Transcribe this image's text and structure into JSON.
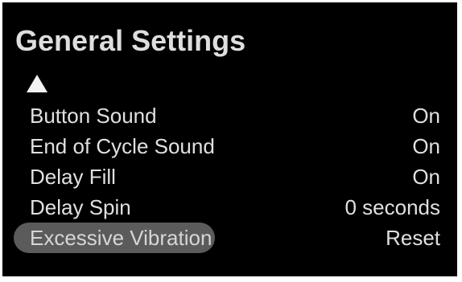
{
  "screen": {
    "title": "General Settings",
    "scroll_up_icon": "triangle-up-icon"
  },
  "menu": {
    "items": [
      {
        "label": "Button Sound",
        "value": "On"
      },
      {
        "label": "End of Cycle Sound",
        "value": "On"
      },
      {
        "label": "Delay Fill",
        "value": "On"
      },
      {
        "label": "Delay Spin",
        "value": "0 seconds"
      },
      {
        "label": "Excessive Vibration",
        "value": "Reset",
        "selected": true
      }
    ]
  },
  "colors": {
    "background": "#000000",
    "text": "#e0e0e0",
    "highlight": "#5b5b5b"
  }
}
